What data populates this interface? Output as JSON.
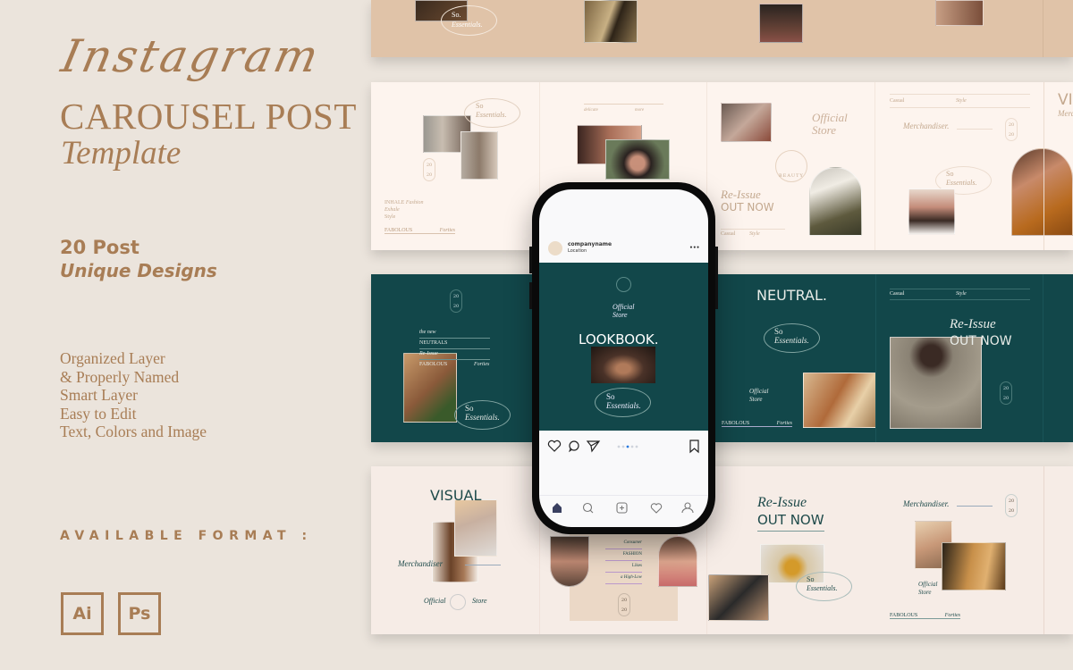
{
  "hero": {
    "script_title": "Instagram",
    "title": "CAROUSEL POST",
    "subtitle": "Template"
  },
  "highlight": {
    "count": "20 Post",
    "label": "Unique Designs"
  },
  "features": [
    "Organized Layer",
    "& Properly Named",
    "Smart Layer",
    "Easy to Edit",
    "Text, Colors and Image"
  ],
  "formats": {
    "heading": "AVAILABLE FORMAT :",
    "items": [
      "Ai",
      "Ps"
    ]
  },
  "colors": {
    "accent": "#a87d55",
    "teal": "#12474a",
    "cream": "#fdf4ee",
    "tan": "#e0c3a8",
    "background": "#ebe4dc"
  },
  "row1": {
    "so": "So.",
    "essentials": "Essentials."
  },
  "row2": {
    "so": "So",
    "essentials": "Essentials.",
    "year_top": "20",
    "year_bottom": "20",
    "inhale": "INHALE",
    "fashion": "Fashion",
    "exhale": "Exhale",
    "style": "Style",
    "fabolous": "FABOLOUS",
    "forties": "Forties",
    "delicate": "delicate",
    "more": "more",
    "official": "Official",
    "store": "Store",
    "logo_text": "BEAUTY",
    "reissue": "Re-Issue",
    "out_now": "OUT NOW",
    "casual": "Casual",
    "style2": "Style",
    "merchandiser": "Merchandiser.",
    "vi": "VI",
    "merc": "Merc"
  },
  "row3": {
    "the_new": "the new",
    "neutrals": "NEUTRALS",
    "re_issue": "Re-Issue",
    "fabolous": "FABOLOUS",
    "forties": "Forties",
    "so": "So",
    "essentials": "Essentials.",
    "year_top": "20",
    "year_bottom": "20",
    "neutral": "NEUTRAL.",
    "official": "Official",
    "store": "Store",
    "casual": "Casual",
    "style": "Style",
    "reissue": "Re-Issue",
    "out_now": "OUT NOW"
  },
  "row4": {
    "visual": "VISUAL",
    "merchandiser": "Merchandiser",
    "official": "Official",
    "store": "Store",
    "consumer": "Consumer",
    "fashion": "FASHION",
    "likes": "Likes",
    "high_low": "a High-Low",
    "year_top": "20",
    "year_bottom": "20",
    "reissue": "Re-Issue",
    "out_now": "OUT NOW",
    "so": "So",
    "essentials": "Essentials.",
    "merchandiser2": "Merchandiser.",
    "official2": "Official",
    "store2": "Store",
    "fabolous": "FABOLOUS",
    "forties": "Forties"
  },
  "phone": {
    "username": "companyname",
    "location": "Location",
    "more": "•••",
    "post": {
      "official": "Official",
      "store": "Store",
      "headline": "LOOKBOOK.",
      "so": "So",
      "essentials": "Essentials."
    },
    "carousel": {
      "total": 5,
      "active": 3
    },
    "icons": [
      "heart-icon",
      "comment-icon",
      "send-icon",
      "bookmark-icon"
    ],
    "nav": [
      "home-icon",
      "search-icon",
      "add-icon",
      "heart-icon",
      "profile-icon"
    ]
  }
}
